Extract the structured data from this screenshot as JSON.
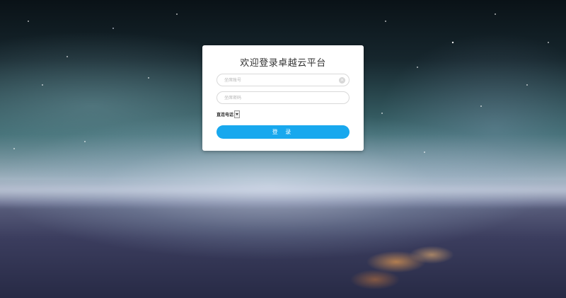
{
  "login": {
    "title": "欢迎登录卓越云平台",
    "username": {
      "placeholder": "坐席账号",
      "value": ""
    },
    "password": {
      "placeholder": "坐席密码",
      "value": ""
    },
    "line_select": {
      "selected": "直连电话"
    },
    "submit_label": "登 录"
  },
  "colors": {
    "accent": "#18a8ee",
    "panel": "#ffffff"
  },
  "icons": {
    "clear": "clear-icon",
    "dropdown": "chevron-down-icon"
  }
}
